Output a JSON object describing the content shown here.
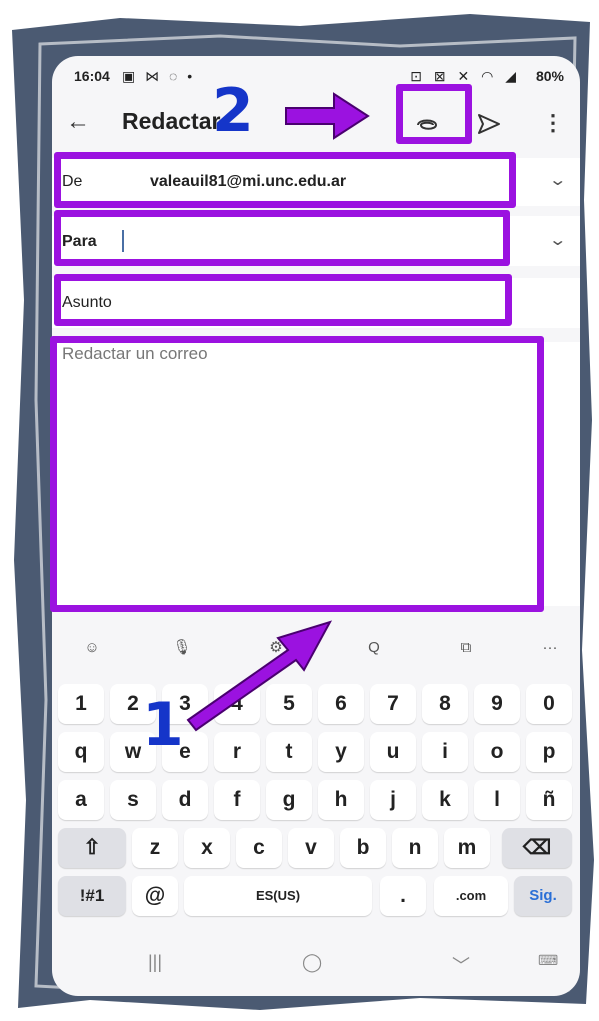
{
  "status": {
    "time": "16:04",
    "left_icons": "▣ ⋈ ◌ •",
    "right_icons": "⊡ ⊠ ✕ ◠ ◢",
    "battery": "80%"
  },
  "appbar": {
    "title": "Redactar",
    "back_icon": "arrow-left",
    "attach_icon": "paperclip",
    "send_icon": "send",
    "more_icon": "more-vertical"
  },
  "form": {
    "from_label": "De",
    "from_value": "valeauil81@mi.unc.edu.ar",
    "to_label": "Para",
    "subject_label": "Asunto",
    "body_placeholder": "Redactar un correo"
  },
  "keyboard": {
    "toolbar": [
      "☺",
      "🎙",
      "⚙",
      "Q",
      "⧉",
      "···"
    ],
    "row_numbers": [
      "1",
      "2",
      "3",
      "4",
      "5",
      "6",
      "7",
      "8",
      "9",
      "0"
    ],
    "row1": [
      "q",
      "w",
      "e",
      "r",
      "t",
      "y",
      "u",
      "i",
      "o",
      "p"
    ],
    "row2": [
      "a",
      "s",
      "d",
      "f",
      "g",
      "h",
      "j",
      "k",
      "l",
      "ñ"
    ],
    "row3": [
      "z",
      "x",
      "c",
      "v",
      "b",
      "n",
      "m"
    ],
    "shift": "⇧",
    "backspace": "⌫",
    "symbols": "!#1",
    "at": "@",
    "space": "ES(US)",
    "period": ".",
    "dotcom": ".com",
    "next": "Sig."
  },
  "nav": {
    "recents": "|||",
    "home": "◯",
    "back": "﹀",
    "keyboard": "⌨"
  },
  "annotations": {
    "label_1": "1",
    "label_2": "2",
    "color": "#9b12e0",
    "number_color": "#1535c9"
  }
}
